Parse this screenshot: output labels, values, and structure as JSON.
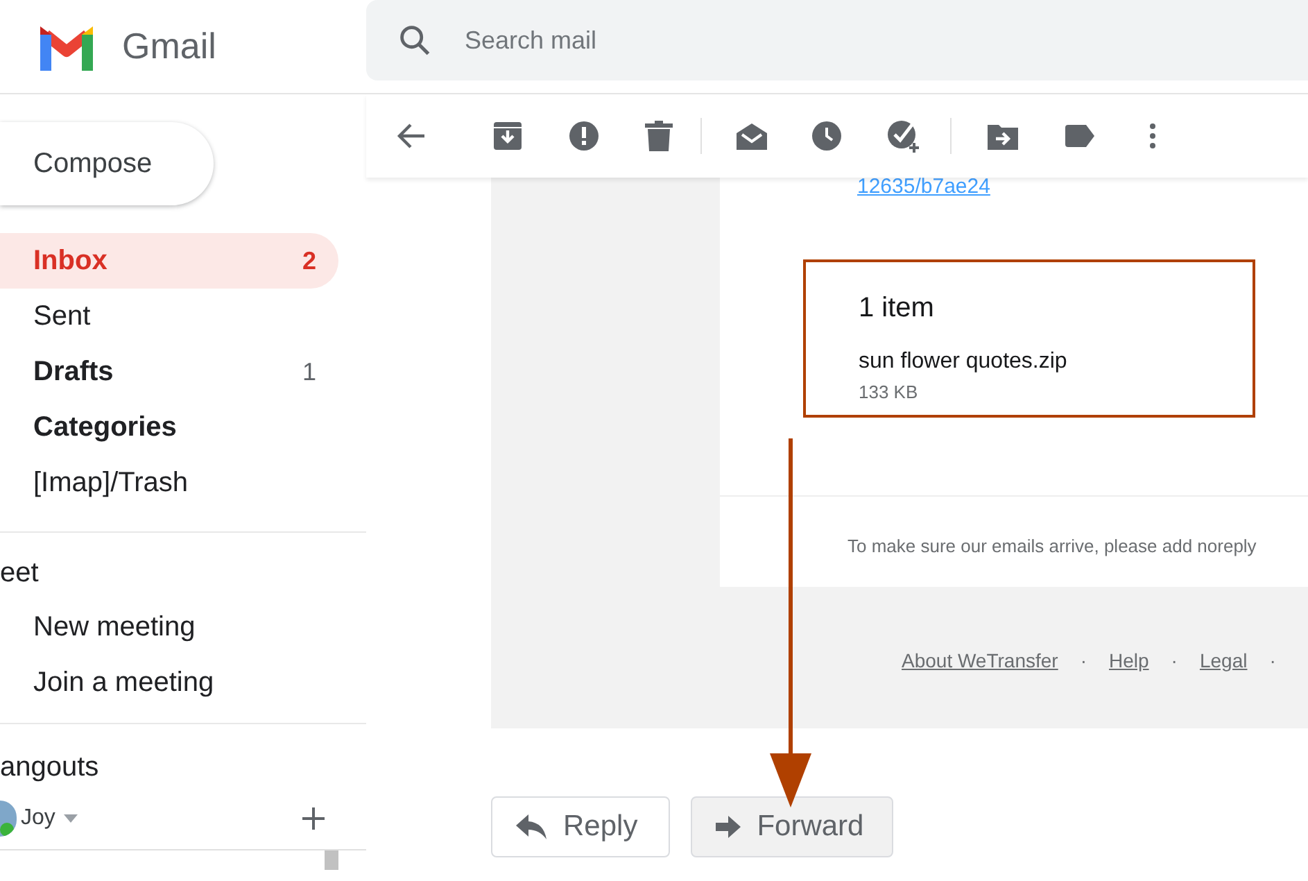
{
  "header": {
    "app_name": "Gmail",
    "search": {
      "placeholder": "Search mail"
    }
  },
  "sidebar": {
    "compose": "Compose",
    "folders": [
      {
        "label": "Inbox",
        "count": "2",
        "selected": true,
        "bold": true
      },
      {
        "label": "Sent",
        "selected": false,
        "bold": false
      },
      {
        "label": "Drafts",
        "count": "1",
        "selected": false,
        "bold": true
      },
      {
        "label": "Categories",
        "selected": false,
        "bold": true
      },
      {
        "label": "[Imap]/Trash",
        "selected": false,
        "bold": false
      }
    ]
  },
  "meet": {
    "title": "eet",
    "items": [
      "New meeting",
      "Join a meeting"
    ]
  },
  "hangouts": {
    "title": "angouts",
    "user": "Joy",
    "online": true
  },
  "message": {
    "link": "12635/b7ae24",
    "transfer": {
      "heading": "1 item",
      "file_name": "sun flower quotes.zip",
      "file_size": "133 KB",
      "highlighted": true
    },
    "notice": "To make sure our emails arrive, please add noreply",
    "footer_links": [
      "About WeTransfer",
      "Help",
      "Legal"
    ],
    "separator": "·"
  },
  "actions": [
    {
      "kind": "reply",
      "label": "Reply",
      "hovered": false
    },
    {
      "kind": "forward",
      "label": "Forward",
      "hovered": true
    }
  ]
}
